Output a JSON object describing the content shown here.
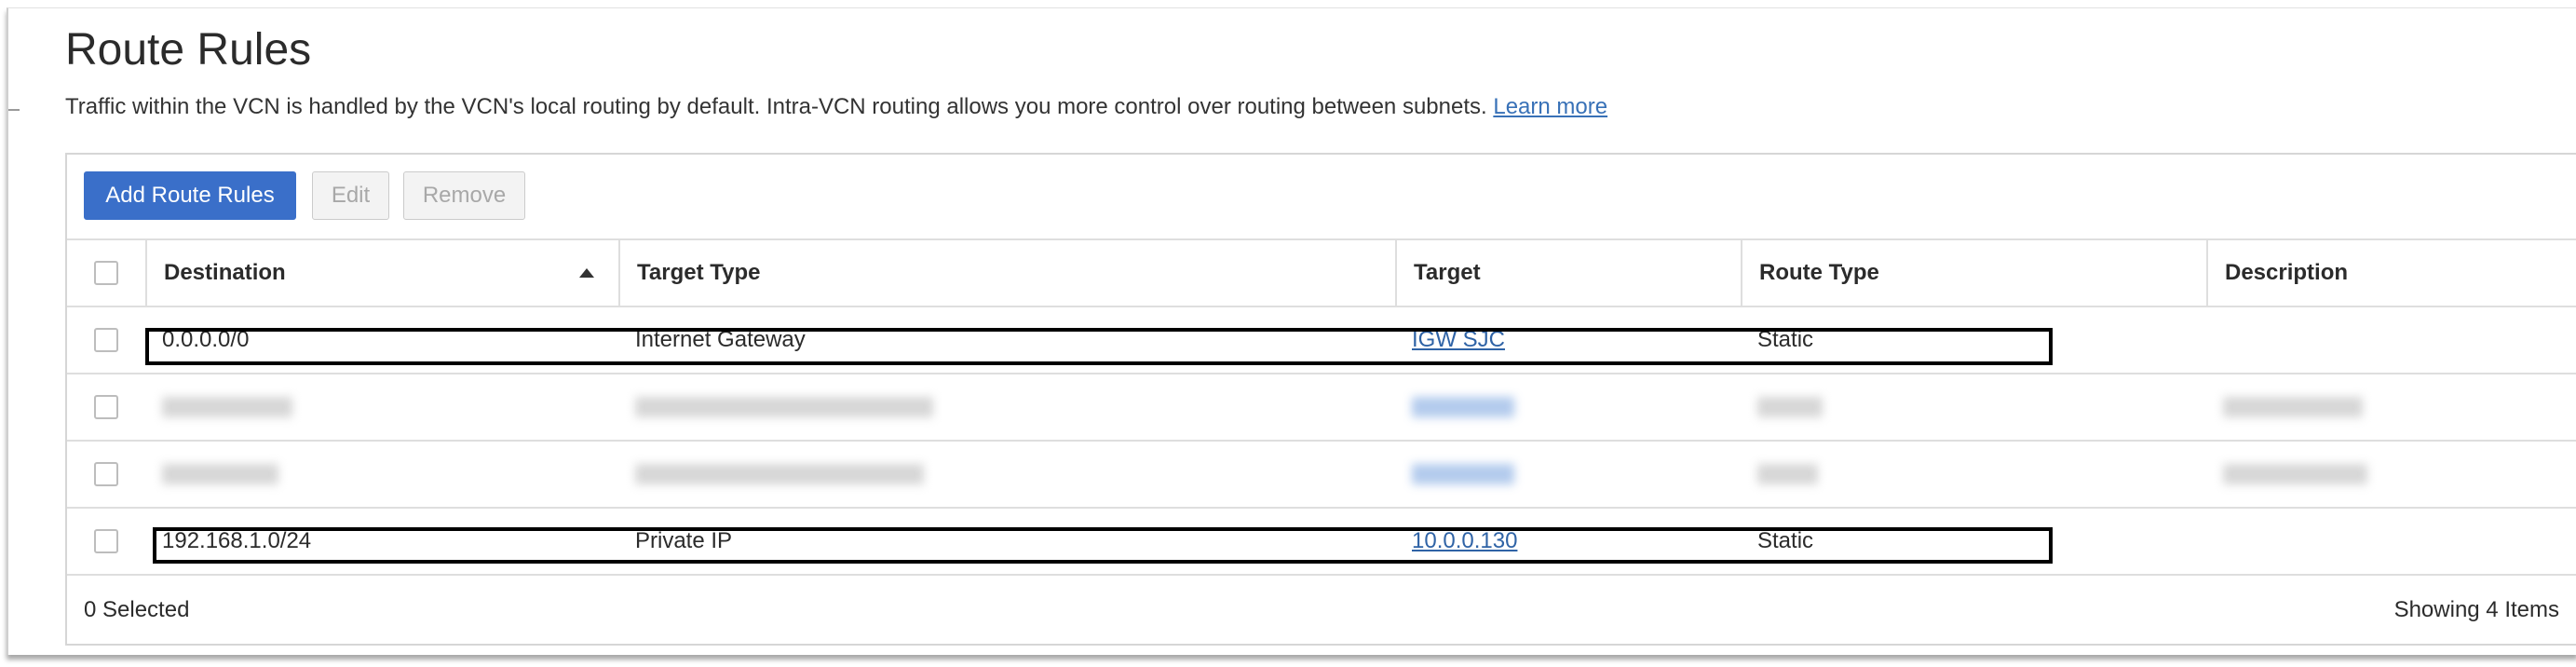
{
  "page": {
    "title": "Route Rules",
    "description": "Traffic within the VCN is handled by the VCN's local routing by default. Intra-VCN routing allows you more control over routing between subnets.",
    "learn_more": "Learn more"
  },
  "toolbar": {
    "add_label": "Add Route Rules",
    "edit_label": "Edit",
    "remove_label": "Remove"
  },
  "table": {
    "columns": {
      "destination": "Destination",
      "target_type": "Target Type",
      "target": "Target",
      "route_type": "Route Type",
      "description": "Description"
    },
    "rows": [
      {
        "destination": "0.0.0.0/0",
        "target_type": "Internet Gateway",
        "target": "IGW SJC",
        "route_type": "Static",
        "description": ""
      },
      {
        "destination": "",
        "target_type": "",
        "target": "",
        "route_type": "",
        "description": "",
        "redacted": true
      },
      {
        "destination": "",
        "target_type": "",
        "target": "",
        "route_type": "",
        "description": "",
        "redacted": true
      },
      {
        "destination": "192.168.1.0/24",
        "target_type": "Private IP",
        "target": "10.0.0.130",
        "route_type": "Static",
        "description": ""
      }
    ],
    "sort": {
      "column": "destination",
      "direction": "ascending"
    },
    "footer": {
      "selected": "0 Selected",
      "showing": "Showing 4 Items"
    }
  },
  "colors": {
    "primary_button": "#3a6fc9",
    "link": "#2f63a6",
    "highlight_box": "#000000"
  }
}
